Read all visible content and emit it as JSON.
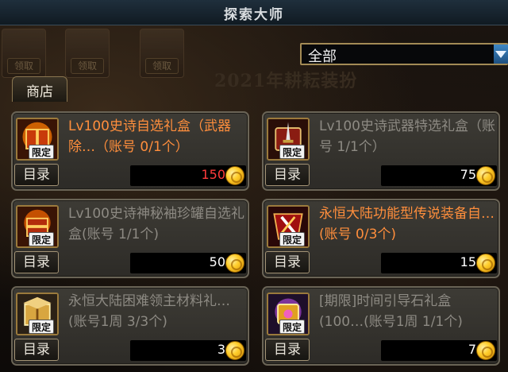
{
  "window": {
    "title": "探索大师"
  },
  "background": {
    "event_title": "2021年耕耘装扮",
    "reward_buttons": [
      "领取",
      "领取",
      "领取"
    ]
  },
  "category_dropdown": {
    "selected": "全部"
  },
  "tabs": {
    "shop": "商店"
  },
  "colors": {
    "card_bg": "#3d3b35",
    "price_normal": "#ffffff",
    "price_highlight": "#ff3b3b",
    "name_grey": "#8d8a83",
    "name_orange": "#ff8e3c",
    "coin_gold": "#ffcd2a"
  },
  "items": [
    {
      "name": "Lv100史诗自选礼盒（武器除…（账号 0/1个）",
      "name_color": "orange",
      "badge": "限定",
      "catalog": "目录",
      "price": "150",
      "price_color": "red",
      "icon": "fire-gift-box-icon"
    },
    {
      "name": "Lv100史诗武器特选礼盒（账号 1/1个）",
      "name_color": "grey",
      "badge": "限定",
      "catalog": "目录",
      "price": "75",
      "price_color": "normal",
      "icon": "sword-gift-box-icon"
    },
    {
      "name": "Lv100史诗神秘袖珍罐自选礼盒(账号 1/1个)",
      "name_color": "grey",
      "badge": "限定",
      "catalog": "目录",
      "price": "50",
      "price_color": "normal",
      "icon": "mystery-jar-box-icon"
    },
    {
      "name": "永恒大陆功能型传说装备自…(账号 0/3个)",
      "name_color": "orange",
      "badge": "限定",
      "catalog": "目录",
      "price": "15",
      "price_color": "normal",
      "icon": "legend-equip-box-icon"
    },
    {
      "name": "永恒大陆困难领主材料礼…(账号1周 3/3个)",
      "name_color": "grey",
      "badge": "限定",
      "catalog": "目录",
      "price": "3",
      "price_color": "normal",
      "icon": "boss-material-box-icon"
    },
    {
      "name": "[期限]时间引导石礼盒(100…(账号1周 1/1个)",
      "name_color": "grey",
      "badge": "限定",
      "catalog": "目录",
      "price": "7",
      "price_color": "normal",
      "icon": "time-stone-box-icon"
    }
  ]
}
